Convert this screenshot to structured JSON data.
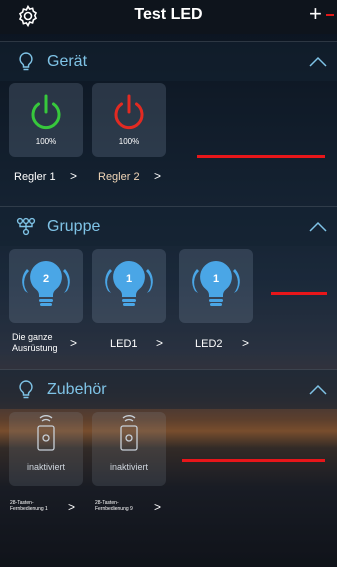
{
  "app": {
    "title": "Test LED"
  },
  "colors": {
    "accent": "#7fc3e6",
    "power_on": "#37c83c",
    "power_off": "#e22a22",
    "bulb": "#4aa6e6"
  },
  "sections": {
    "geraet": {
      "label": "Gerät",
      "items": [
        {
          "label": "Regler 1",
          "percent": "100%",
          "state": "on"
        },
        {
          "label": "Regler 2",
          "percent": "100%",
          "state": "off"
        }
      ]
    },
    "gruppe": {
      "label": "Gruppe",
      "items": [
        {
          "label": "Die ganze Ausrüstung",
          "count": "2"
        },
        {
          "label": "LED1",
          "count": "1"
        },
        {
          "label": "LED2",
          "count": "1"
        }
      ]
    },
    "zubehoer": {
      "label": "Zubehör",
      "items": [
        {
          "label": "28-Tasten-Fernbedienung 1",
          "status": "inaktiviert"
        },
        {
          "label": "28-Tasten-Fernbedienung 9",
          "status": "inaktiviert"
        }
      ]
    }
  },
  "icons": {
    "settings": "gear-icon",
    "add": "plus-icon",
    "section_device": "lightbulb-outline-icon",
    "section_group": "group-icon",
    "section_accessory": "lightbulb-outline-icon",
    "collapse": "chevron-up-icon",
    "navigate": "chevron-right-icon"
  }
}
